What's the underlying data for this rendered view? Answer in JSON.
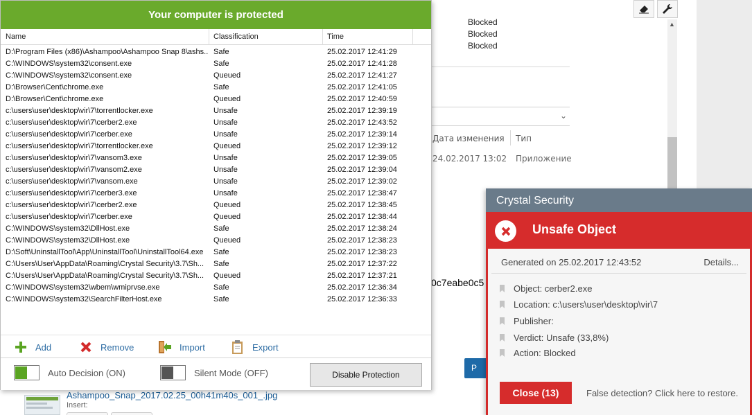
{
  "background": {
    "blocked_labels": [
      "Blocked",
      "Blocked",
      "Blocked"
    ],
    "columns": {
      "date_modified": "Дата изменения",
      "type": "Тип"
    },
    "file_row": {
      "date": "24.02.2017 13:02",
      "type": "Приложение"
    },
    "hash_fragment": "0c7eabe0c5",
    "blue_button_fragment": "P",
    "file_name": "Ashampoo_Snap_2017.02.25_00h41m40s_001_.jpg",
    "insert_label": "Insert:"
  },
  "app": {
    "title": "Your computer is protected",
    "columns": {
      "name": "Name",
      "classification": "Classification",
      "time": "Time"
    },
    "rows": [
      {
        "name": "D:\\Program Files (x86)\\Ashampoo\\Ashampoo Snap 8\\ashs...",
        "classification": "Safe",
        "time": "25.02.2017 12:41:29"
      },
      {
        "name": "C:\\WINDOWS\\system32\\consent.exe",
        "classification": "Safe",
        "time": "25.02.2017 12:41:28"
      },
      {
        "name": "C:\\WINDOWS\\system32\\consent.exe",
        "classification": "Queued",
        "time": "25.02.2017 12:41:27"
      },
      {
        "name": "D:\\Browser\\Cent\\chrome.exe",
        "classification": "Safe",
        "time": "25.02.2017 12:41:05"
      },
      {
        "name": "D:\\Browser\\Cent\\chrome.exe",
        "classification": "Queued",
        "time": "25.02.2017 12:40:59"
      },
      {
        "name": "c:\\users\\user\\desktop\\vir\\7\\torrentlocker.exe",
        "classification": "Unsafe",
        "time": "25.02.2017 12:39:19"
      },
      {
        "name": "c:\\users\\user\\desktop\\vir\\7\\cerber2.exe",
        "classification": "Unsafe",
        "time": "25.02.2017 12:43:52"
      },
      {
        "name": "c:\\users\\user\\desktop\\vir\\7\\cerber.exe",
        "classification": "Unsafe",
        "time": "25.02.2017 12:39:14"
      },
      {
        "name": "c:\\users\\user\\desktop\\vir\\7\\torrentlocker.exe",
        "classification": "Queued",
        "time": "25.02.2017 12:39:12"
      },
      {
        "name": "c:\\users\\user\\desktop\\vir\\7\\vansom3.exe",
        "classification": "Unsafe",
        "time": "25.02.2017 12:39:05"
      },
      {
        "name": "c:\\users\\user\\desktop\\vir\\7\\vansom2.exe",
        "classification": "Unsafe",
        "time": "25.02.2017 12:39:04"
      },
      {
        "name": "c:\\users\\user\\desktop\\vir\\7\\vansom.exe",
        "classification": "Unsafe",
        "time": "25.02.2017 12:39:02"
      },
      {
        "name": "c:\\users\\user\\desktop\\vir\\7\\cerber3.exe",
        "classification": "Unsafe",
        "time": "25.02.2017 12:38:47"
      },
      {
        "name": "c:\\users\\user\\desktop\\vir\\7\\cerber2.exe",
        "classification": "Queued",
        "time": "25.02.2017 12:38:45"
      },
      {
        "name": "c:\\users\\user\\desktop\\vir\\7\\cerber.exe",
        "classification": "Queued",
        "time": "25.02.2017 12:38:44"
      },
      {
        "name": "C:\\WINDOWS\\system32\\DllHost.exe",
        "classification": "Safe",
        "time": "25.02.2017 12:38:24"
      },
      {
        "name": "C:\\WINDOWS\\system32\\DllHost.exe",
        "classification": "Queued",
        "time": "25.02.2017 12:38:23"
      },
      {
        "name": "D:\\Soft\\UninstallTool\\App\\UninstallTool\\UninstallTool64.exe",
        "classification": "Safe",
        "time": "25.02.2017 12:38:23"
      },
      {
        "name": "C:\\Users\\User\\AppData\\Roaming\\Crystal Security\\3.7\\Sh...",
        "classification": "Safe",
        "time": "25.02.2017 12:37:22"
      },
      {
        "name": "C:\\Users\\User\\AppData\\Roaming\\Crystal Security\\3.7\\Sh...",
        "classification": "Queued",
        "time": "25.02.2017 12:37:21"
      },
      {
        "name": "C:\\WINDOWS\\system32\\wbem\\wmiprvse.exe",
        "classification": "Safe",
        "time": "25.02.2017 12:36:34"
      },
      {
        "name": "C:\\WINDOWS\\system32\\SearchFilterHost.exe",
        "classification": "Safe",
        "time": "25.02.2017 12:36:33"
      }
    ],
    "actions": {
      "add": "Add",
      "remove": "Remove",
      "import": "Import",
      "export": "Export"
    },
    "auto_decision": {
      "label": "Auto Decision (ON)",
      "on": true
    },
    "silent_mode": {
      "label": "Silent Mode (OFF)",
      "on": false
    },
    "disable_button": "Disable Protection",
    "colors": {
      "header": "#6aaa2c",
      "toggle_on": "#5aa422",
      "toggle_off": "#555555"
    }
  },
  "popup": {
    "app_name": "Crystal Security",
    "heading": "Unsafe Object",
    "generated": "Generated on 25.02.2017 12:43:52",
    "details_link": "Details...",
    "properties": [
      "Object: cerber2.exe",
      "Location: c:\\users\\user\\desktop\\vir\\7",
      "Publisher:",
      "Verdict: Unsafe (33,8%)",
      "Action: Blocked"
    ],
    "close_button": "Close (13)",
    "false_detection": "False detection? Click here to restore.",
    "colors": {
      "accent": "#d62c2c",
      "title_bar": "#6a7b8a"
    }
  }
}
